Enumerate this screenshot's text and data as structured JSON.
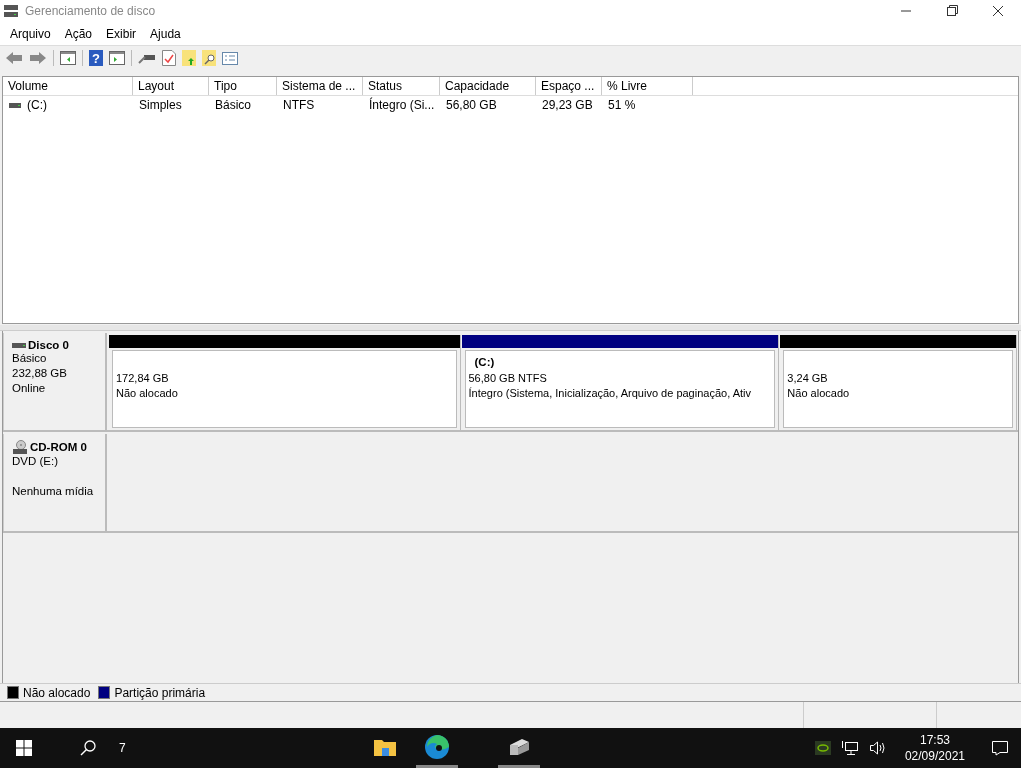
{
  "window": {
    "title": "Gerenciamento de disco"
  },
  "menu": [
    "Arquivo",
    "Ação",
    "Exibir",
    "Ajuda"
  ],
  "table": {
    "columns": [
      "Volume",
      "Layout",
      "Tipo",
      "Sistema de ...",
      "Status",
      "Capacidade",
      "Espaço ...",
      "% Livre"
    ],
    "rows": [
      [
        "(C:)",
        "Simples",
        "Básico",
        "NTFS",
        "Íntegro (Si...",
        "56,80 GB",
        "29,23 GB",
        "51 %"
      ]
    ]
  },
  "disks": [
    {
      "kind": "disk",
      "name": "Disco 0",
      "lines": [
        "Básico",
        "232,88 GB"
      ],
      "status": "Online",
      "partitions": [
        {
          "color": "#000000",
          "size": "172,84 GB",
          "status": "Não alocado"
        },
        {
          "color": "#000080",
          "title": "(C:)",
          "size": "56,80 GB NTFS",
          "status": "Íntegro (Sistema, Inicialização, Arquivo de paginação, Ativ"
        },
        {
          "color": "#000000",
          "size": "3,24 GB",
          "status": "Não alocado"
        }
      ]
    },
    {
      "kind": "cdrom",
      "name": "CD-ROM 0",
      "lines": [
        "DVD (E:)"
      ],
      "status": "Nenhuma mídia"
    }
  ],
  "toolbar": {
    "help_glyph": "?"
  },
  "legend": [
    {
      "color": "#000000",
      "label": "Não alocado"
    },
    {
      "color": "#000080",
      "label": "Partição primária"
    }
  ],
  "taskbar": {
    "search_count": "7",
    "apps": [
      {
        "kind": "explorer",
        "open": false
      },
      {
        "kind": "edge",
        "open": true
      },
      {
        "kind": "diskmgmt",
        "open": true
      }
    ],
    "time": "17:53",
    "date": "02/09/2021"
  }
}
